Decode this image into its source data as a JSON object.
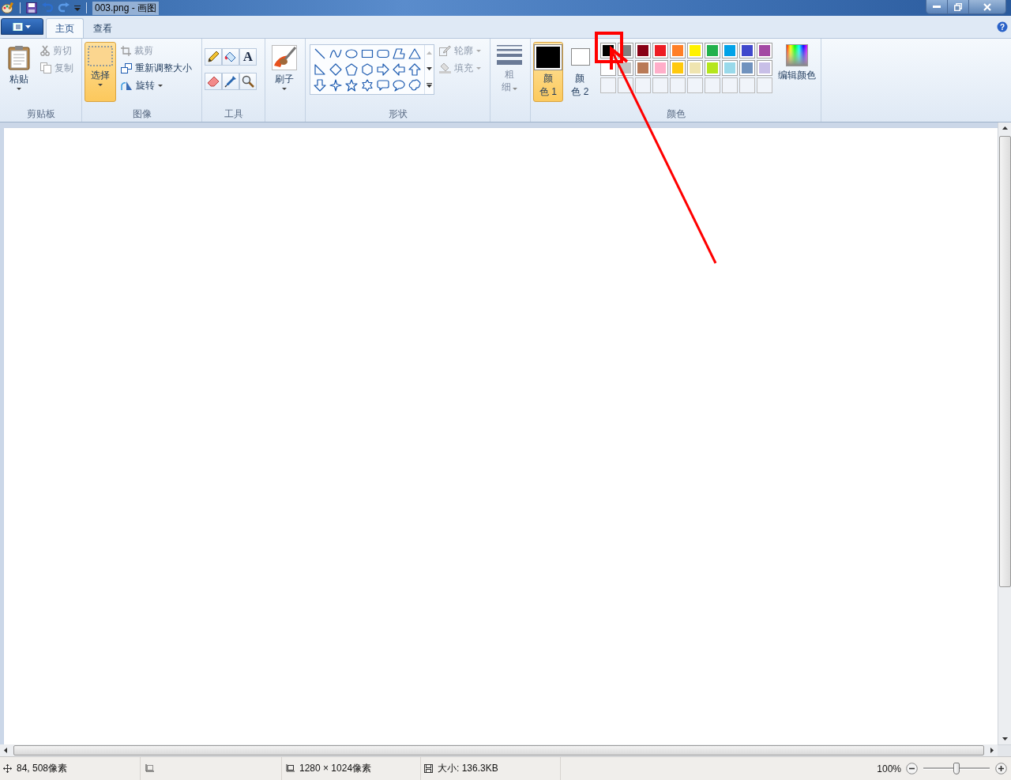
{
  "window": {
    "title": "003.png - 画图"
  },
  "tabs": [
    {
      "label": "主页",
      "selected": true
    },
    {
      "label": "查看",
      "selected": false
    }
  ],
  "help": "?",
  "clipboard": {
    "label": "剪贴板",
    "paste": "粘贴",
    "cut": {
      "label": "剪切",
      "disabled": true
    },
    "copy": {
      "label": "复制",
      "disabled": true
    }
  },
  "image": {
    "label": "图像",
    "select": {
      "label": "选择",
      "selected": true
    },
    "crop": {
      "label": "裁剪",
      "disabled": true
    },
    "resize": {
      "label": "重新调整大小",
      "disabled": false
    },
    "rotate": {
      "label": "旋转",
      "disabled": false
    }
  },
  "tools": {
    "label": "工具",
    "text_tool": "A"
  },
  "brushes": {
    "label": "刷子"
  },
  "shapes": {
    "label": "形状",
    "outline": {
      "label": "轮廓",
      "disabled": true
    },
    "fill": {
      "label": "填充",
      "disabled": true
    }
  },
  "size": {
    "label": "粗细"
  },
  "colors": {
    "label": "颜色",
    "edit": "编辑颜色",
    "current": [
      {
        "label": "颜色 1",
        "color": "#000000",
        "selected": true
      },
      {
        "label": "颜色 2",
        "color": "#ffffff",
        "selected": false
      }
    ],
    "palette": [
      {
        "color": "#000000"
      },
      {
        "color": "#7f7f7f"
      },
      {
        "color": "#880015"
      },
      {
        "color": "#ed1c24"
      },
      {
        "color": "#ff7f27"
      },
      {
        "color": "#fff200"
      },
      {
        "color": "#22b14c"
      },
      {
        "color": "#00a2e8"
      },
      {
        "color": "#3f48cc"
      },
      {
        "color": "#a349a4"
      },
      {
        "color": "#ffffff"
      },
      {
        "color": "#c3c3c3"
      },
      {
        "color": "#b97a57"
      },
      {
        "color": "#ffaec9"
      },
      {
        "color": "#ffc90e"
      },
      {
        "color": "#efe4b0"
      },
      {
        "color": "#b5e61d"
      },
      {
        "color": "#99d9ea"
      },
      {
        "color": "#7092be"
      },
      {
        "color": "#c8bfe7"
      }
    ]
  },
  "status_bar": {
    "cursor": "84, 508像素",
    "image_size": "1280 × 1024像素",
    "file_size": "大小: 136.3KB",
    "zoom": "100%",
    "zoom_slider": {
      "level": 0.5
    }
  }
}
